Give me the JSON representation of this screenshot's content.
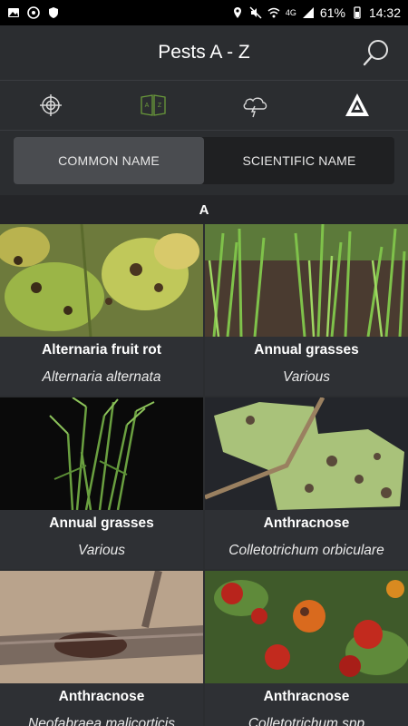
{
  "status_bar": {
    "battery": "61%",
    "time": "14:32",
    "network": "4G"
  },
  "header": {
    "title": "Pests A - Z"
  },
  "icon_tabs": [
    {
      "icon": "crosshair-icon"
    },
    {
      "icon": "book-az-icon"
    },
    {
      "icon": "weather-icon"
    },
    {
      "icon": "a-triangle-icon"
    }
  ],
  "segments": {
    "common": "COMMON NAME",
    "scientific": "SCIENTIFIC NAME"
  },
  "section_letter": "A",
  "pests": [
    {
      "common": "Alternaria fruit rot",
      "scientific": "Alternaria alternata"
    },
    {
      "common": "Annual grasses",
      "scientific": "Various"
    },
    {
      "common": "Annual grasses",
      "scientific": "Various"
    },
    {
      "common": "Anthracnose",
      "scientific": "Colletotrichum orbiculare"
    },
    {
      "common": "Anthracnose",
      "scientific": "Neofabraea malicorticis"
    },
    {
      "common": "Anthracnose",
      "scientific": "Colletotrichum spp"
    }
  ],
  "colors": {
    "background": "#2b2d30",
    "accent_green": "#6a9a3a",
    "active_segment": "#4a4c50"
  }
}
